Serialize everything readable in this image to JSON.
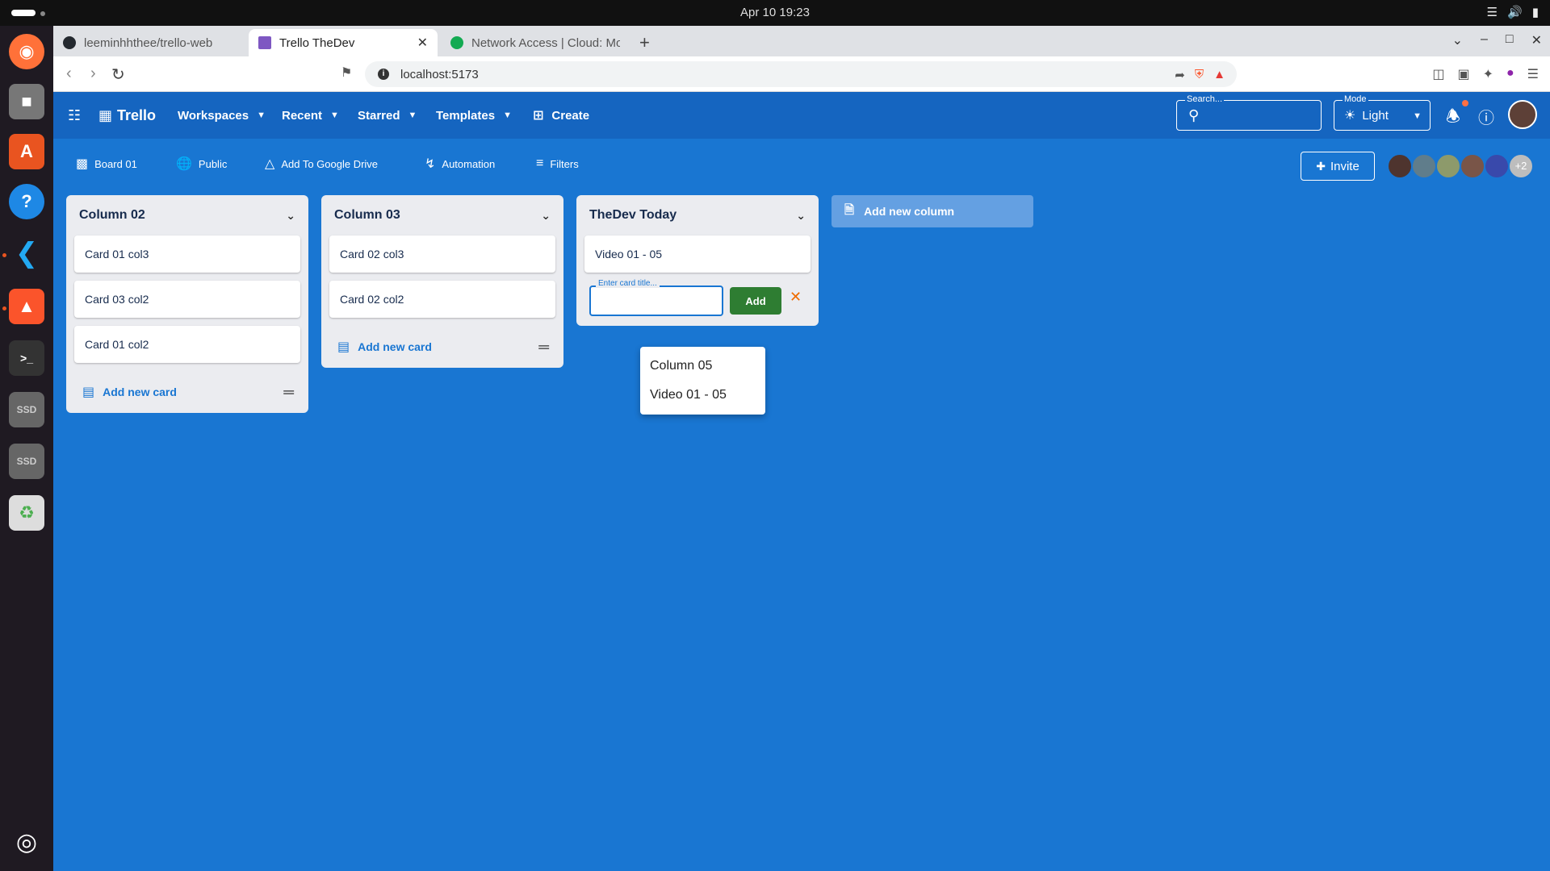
{
  "system": {
    "clock": "Apr 10  19:23"
  },
  "browser": {
    "tabs": [
      {
        "title": "leeminhhthee/trello-web",
        "active": false
      },
      {
        "title": "Trello TheDev",
        "active": true
      },
      {
        "title": "Network Access | Cloud: Mo",
        "active": false
      }
    ],
    "url": "localhost:5173"
  },
  "app": {
    "brand": "Trello",
    "nav": [
      {
        "label": "Workspaces"
      },
      {
        "label": "Recent"
      },
      {
        "label": "Starred"
      },
      {
        "label": "Templates"
      }
    ],
    "create_label": "Create",
    "search_label": "Search...",
    "mode_label": "Mode",
    "mode_value": "Light"
  },
  "board": {
    "name": "Board 01",
    "visibility": "Public",
    "drive": "Add To Google Drive",
    "automation": "Automation",
    "filters": "Filters",
    "invite": "Invite",
    "members_more": "+2"
  },
  "columns": [
    {
      "title": "Column 02",
      "cards": [
        "Card 01 col3",
        "Card 03 col2",
        "Card 01 col2"
      ],
      "add_label": "Add new card"
    },
    {
      "title": "Column 03",
      "cards": [
        "Card 02 col3",
        "Card 02 col2"
      ],
      "add_label": "Add new card"
    },
    {
      "title": "TheDev Today",
      "cards": [
        "Video 01 - 05"
      ],
      "input_label": "Enter card title...",
      "add_btn": "Add"
    }
  ],
  "suggestions": [
    "Column 05",
    "Video 01 - 05"
  ],
  "add_column_label": "Add new column",
  "colors": {
    "app_bar": "#1565c0",
    "board_bg": "#1976d2",
    "add_button": "#2e7d32",
    "close_icon": "#ef6c00"
  }
}
